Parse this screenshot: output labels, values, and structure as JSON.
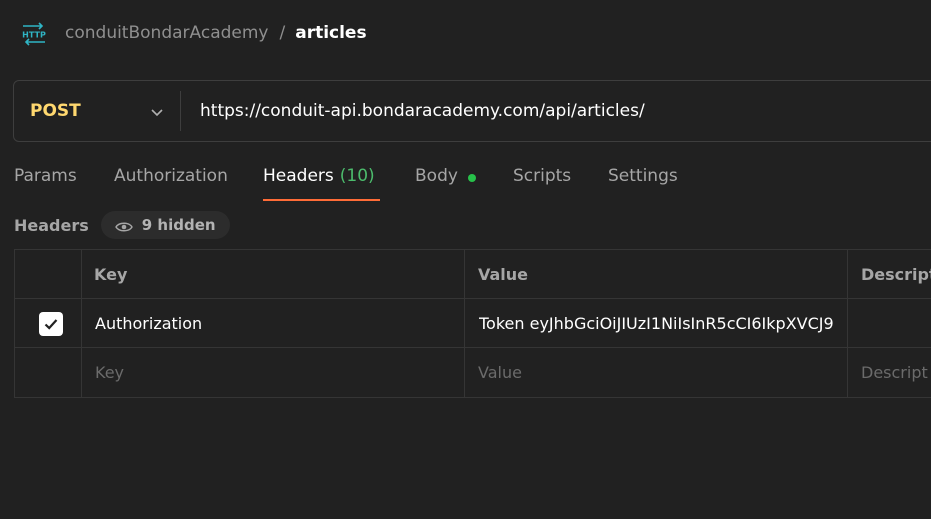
{
  "breadcrumb": {
    "icon": "http-icon",
    "collection": "conduitBondarAcademy",
    "separator": "/",
    "request": "articles"
  },
  "request": {
    "method": "POST",
    "url": "https://conduit-api.bondaracademy.com/api/articles/"
  },
  "tabs": [
    {
      "label": "Params"
    },
    {
      "label": "Authorization"
    },
    {
      "label": "Headers",
      "count": "(10)",
      "active": true
    },
    {
      "label": "Body",
      "indicator": "green-dot"
    },
    {
      "label": "Scripts"
    },
    {
      "label": "Settings"
    }
  ],
  "headers_section": {
    "title": "Headers",
    "hidden_label": "9 hidden"
  },
  "table": {
    "columns": [
      "Key",
      "Value",
      "Descript"
    ],
    "rows": [
      {
        "checked": true,
        "key": "Authorization",
        "value": "Token eyJhbGciOiJIUzI1NiIsInR5cCI6IkpXVCJ9",
        "description": ""
      }
    ],
    "placeholder": {
      "key": "Key",
      "value": "Value",
      "description": "Descript"
    }
  },
  "colors": {
    "background": "#212121",
    "method": "#ffd86f",
    "accent": "#ff6c37",
    "count": "#4cbb6c",
    "http_icon": "#2fb5c5"
  }
}
